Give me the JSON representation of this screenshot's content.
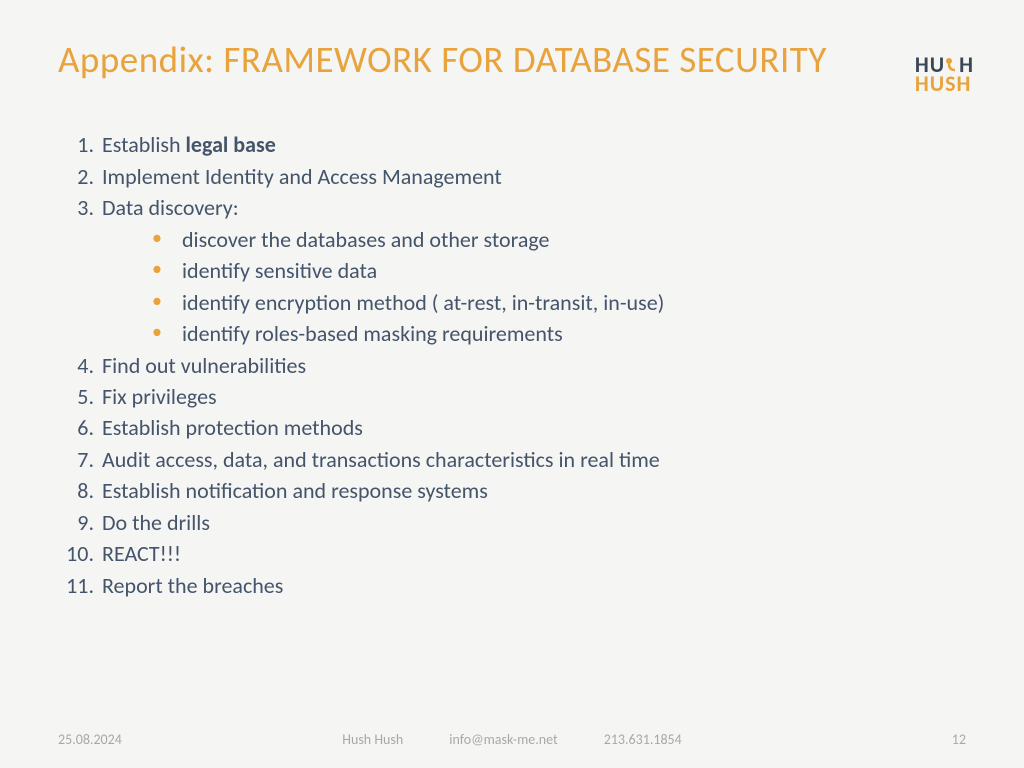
{
  "title": "Appendix: FRAMEWORK FOR DATABASE SECURITY",
  "logo": {
    "line1_a": "HU",
    "line1_b": "H",
    "line2": "HUSH"
  },
  "items": {
    "i1_prefix": "Establish ",
    "i1_bold": "legal base",
    "i2": "Implement Identity and Access Management",
    "i3": "Data discovery:",
    "i3_sub": {
      "s1": "discover the databases and other storage",
      "s2": "identify sensitive data",
      "s3": "identify encryption method ( at-rest, in-transit, in-use)",
      "s4": "identify roles-based masking requirements"
    },
    "i4": "Find out vulnerabilities",
    "i5": "Fix privileges",
    "i6": "Establish protection methods",
    "i7": "Audit access, data, and transactions characteristics in real time",
    "i8": "Establish notification and response systems",
    "i9": "Do the drills",
    "i10": "REACT!!!",
    "i11": "Report the breaches"
  },
  "footer": {
    "date": "25.08.2024",
    "company": "Hush Hush",
    "email": "info@mask-me.net",
    "phone": "213.631.1854",
    "page": "12"
  }
}
